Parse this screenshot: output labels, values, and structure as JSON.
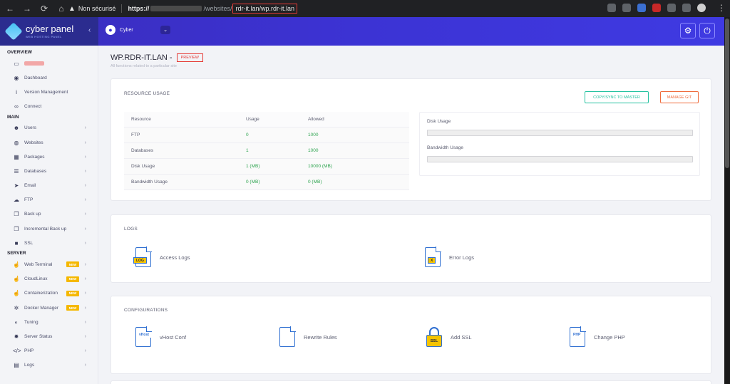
{
  "browser": {
    "security_label": "Non sécurisé",
    "url_scheme": "https://",
    "url_path": "/websites/",
    "url_highlight": "rdr-it.lan/wp.rdr-it.lan"
  },
  "header": {
    "brand": "cyber panel",
    "brand_sub": "WEB HOSTING PANEL",
    "user_name": "Cyber"
  },
  "sidebar": {
    "sections": [
      {
        "title": "OVERVIEW",
        "items": [
          {
            "label": "",
            "icon": "laptop-icon",
            "blurred": true
          },
          {
            "label": "Dashboard",
            "icon": "dashboard-icon"
          },
          {
            "label": "Version Management",
            "icon": "info-icon"
          },
          {
            "label": "Connect",
            "icon": "link-icon"
          }
        ]
      },
      {
        "title": "MAIN",
        "items": [
          {
            "label": "Users",
            "icon": "users-icon",
            "caret": true
          },
          {
            "label": "Websites",
            "icon": "globe-icon",
            "caret": true
          },
          {
            "label": "Packages",
            "icon": "cubes-icon",
            "caret": true
          },
          {
            "label": "Databases",
            "icon": "database-icon",
            "caret": true
          },
          {
            "label": "Email",
            "icon": "send-icon",
            "caret": true
          },
          {
            "label": "FTP",
            "icon": "cloud-upload-icon",
            "caret": true
          },
          {
            "label": "Back up",
            "icon": "copy-icon",
            "caret": true
          },
          {
            "label": "Incremental Back up",
            "icon": "copy-icon",
            "caret": true
          },
          {
            "label": "SSL",
            "icon": "lock-icon",
            "caret": true
          }
        ]
      },
      {
        "title": "SERVER",
        "items": [
          {
            "label": "Web Terminal",
            "icon": "hand-pointer-icon",
            "caret": true,
            "badge": "NEW"
          },
          {
            "label": "CloudLinux",
            "icon": "hand-pointer-icon",
            "caret": true,
            "badge": "NEW"
          },
          {
            "label": "Containerization",
            "icon": "hand-pointer-icon",
            "caret": true,
            "badge": "NEW"
          },
          {
            "label": "Docker Manager",
            "icon": "cogs-icon",
            "caret": true,
            "badge": "NEW"
          },
          {
            "label": "Tuning",
            "icon": "adjust-icon",
            "caret": true
          },
          {
            "label": "Server Status",
            "icon": "cog-icon",
            "caret": true
          },
          {
            "label": "PHP",
            "icon": "code-icon",
            "caret": true
          },
          {
            "label": "Logs",
            "icon": "file-icon",
            "caret": true
          }
        ]
      }
    ]
  },
  "page": {
    "title": "WP.RDR-IT.LAN -",
    "preview_label": "PREVIEW",
    "subtitle": "All functions related to a particular site"
  },
  "resource_usage": {
    "title": "RESOURCE USAGE",
    "copy_sync_label": "COPY/SYNC TO MASTER",
    "manage_git_label": "MANAGE GIT",
    "headers": [
      "Resource",
      "Usage",
      "Allowed"
    ],
    "rows": [
      {
        "resource": "FTP",
        "usage": "0",
        "allowed": "1000"
      },
      {
        "resource": "Databases",
        "usage": "1",
        "allowed": "1000"
      },
      {
        "resource": "Disk Usage",
        "usage": "1 (MB)",
        "allowed": "10000 (MB)"
      },
      {
        "resource": "Bandwidth Usage",
        "usage": "0 (MB)",
        "allowed": "0 (MB)"
      }
    ],
    "disk_usage_label": "Disk Usage",
    "bandwidth_usage_label": "Bandwidth Usage"
  },
  "logs": {
    "title": "LOGS",
    "access_logs": "Access Logs",
    "access_tag": "LOG",
    "error_logs": "Error Logs",
    "error_tag": "X"
  },
  "configurations": {
    "title": "CONFIGURATIONS",
    "vhost": "vHost Conf",
    "vhost_tag": "vHost",
    "rewrite": "Rewrite Rules",
    "add_ssl": "Add SSL",
    "ssl_tag": "SSL",
    "change_php": "Change PHP",
    "php_tag": "PHP"
  }
}
